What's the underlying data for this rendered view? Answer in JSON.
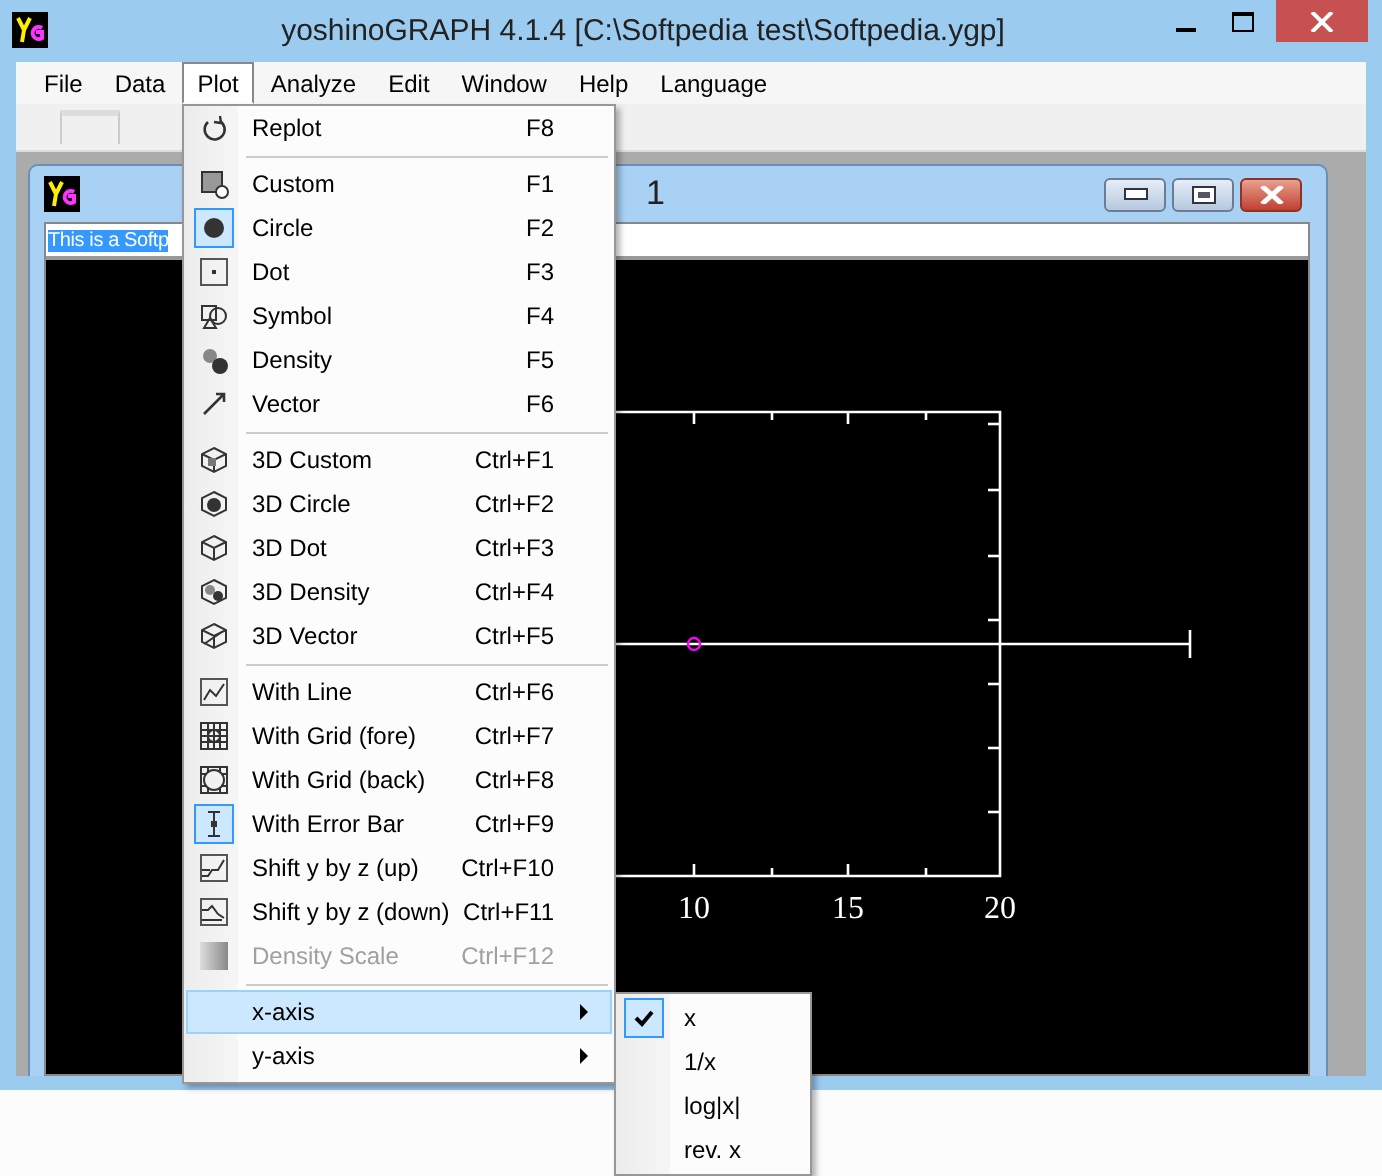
{
  "window": {
    "title": "yoshinoGRAPH 4.1.4 [C:\\Softpedia test\\Softpedia.ygp]"
  },
  "menubar": [
    {
      "label": "File",
      "selected": false
    },
    {
      "label": "Data",
      "selected": false
    },
    {
      "label": "Plot",
      "selected": true
    },
    {
      "label": "Analyze",
      "selected": false
    },
    {
      "label": "Edit",
      "selected": false
    },
    {
      "label": "Window",
      "selected": false
    },
    {
      "label": "Help",
      "selected": false
    },
    {
      "label": "Language",
      "selected": false
    }
  ],
  "document_window": {
    "title": "1",
    "text_field": {
      "value": "This is a Softp",
      "selected": true
    }
  },
  "plot": {
    "x_tick_labels": [
      "10",
      "15",
      "20"
    ]
  },
  "plot_menu": {
    "sections": [
      {
        "items": [
          {
            "kind": "command",
            "label": "Replot",
            "shortcut": "F8",
            "checked": false,
            "disabled": false,
            "selected": false
          }
        ]
      },
      {
        "items": [
          {
            "kind": "command",
            "label": "Custom",
            "shortcut": "F1",
            "checked": false,
            "disabled": false,
            "selected": false
          },
          {
            "kind": "command",
            "label": "Circle",
            "shortcut": "F2",
            "checked": true,
            "disabled": false,
            "selected": false
          },
          {
            "kind": "command",
            "label": "Dot",
            "shortcut": "F3",
            "checked": false,
            "disabled": false,
            "selected": false
          },
          {
            "kind": "command",
            "label": "Symbol",
            "shortcut": "F4",
            "checked": false,
            "disabled": false,
            "selected": false
          },
          {
            "kind": "command",
            "label": "Density",
            "shortcut": "F5",
            "checked": false,
            "disabled": false,
            "selected": false
          },
          {
            "kind": "command",
            "label": "Vector",
            "shortcut": "F6",
            "checked": false,
            "disabled": false,
            "selected": false
          }
        ]
      },
      {
        "items": [
          {
            "kind": "command",
            "label": "3D Custom",
            "shortcut": "Ctrl+F1",
            "checked": false,
            "disabled": false,
            "selected": false
          },
          {
            "kind": "command",
            "label": "3D Circle",
            "shortcut": "Ctrl+F2",
            "checked": false,
            "disabled": false,
            "selected": false
          },
          {
            "kind": "command",
            "label": "3D Dot",
            "shortcut": "Ctrl+F3",
            "checked": false,
            "disabled": false,
            "selected": false
          },
          {
            "kind": "command",
            "label": "3D Density",
            "shortcut": "Ctrl+F4",
            "checked": false,
            "disabled": false,
            "selected": false
          },
          {
            "kind": "command",
            "label": "3D Vector",
            "shortcut": "Ctrl+F5",
            "checked": false,
            "disabled": false,
            "selected": false
          }
        ]
      },
      {
        "items": [
          {
            "kind": "command",
            "label": "With Line",
            "shortcut": "Ctrl+F6",
            "checked": false,
            "disabled": false,
            "selected": false
          },
          {
            "kind": "command",
            "label": "With Grid (fore)",
            "shortcut": "Ctrl+F7",
            "checked": false,
            "disabled": false,
            "selected": false
          },
          {
            "kind": "command",
            "label": "With Grid (back)",
            "shortcut": "Ctrl+F8",
            "checked": false,
            "disabled": false,
            "selected": false
          },
          {
            "kind": "command",
            "label": "With Error Bar",
            "shortcut": "Ctrl+F9",
            "checked": true,
            "disabled": false,
            "selected": false
          },
          {
            "kind": "command",
            "label": "Shift y by z (up)",
            "shortcut": "Ctrl+F10",
            "checked": false,
            "disabled": false,
            "selected": false
          },
          {
            "kind": "command",
            "label": "Shift y by z (down)",
            "shortcut": "Ctrl+F11",
            "checked": false,
            "disabled": false,
            "selected": false
          },
          {
            "kind": "command",
            "label": "Density Scale",
            "shortcut": "Ctrl+F12",
            "checked": false,
            "disabled": true,
            "selected": false
          }
        ]
      },
      {
        "items": [
          {
            "kind": "submenu",
            "label": "x-axis",
            "checked": false,
            "disabled": false,
            "selected": true
          },
          {
            "kind": "submenu",
            "label": "y-axis",
            "checked": false,
            "disabled": false,
            "selected": false
          }
        ]
      }
    ]
  },
  "x_axis_submenu": {
    "items": [
      {
        "label": "x",
        "checked": true
      },
      {
        "label": "1/x",
        "checked": false
      },
      {
        "label": "log|x|",
        "checked": false
      },
      {
        "label": "rev. x",
        "checked": false
      }
    ]
  }
}
